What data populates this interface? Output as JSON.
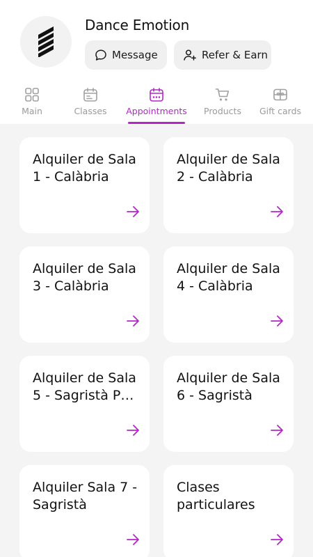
{
  "studio": {
    "name": "Dance Emotion"
  },
  "actions": {
    "message_label": "Message",
    "refer_label": "Refer & Earn"
  },
  "tabs": [
    {
      "label": "Main",
      "icon": "grid-icon",
      "active": false
    },
    {
      "label": "Classes",
      "icon": "calendar-icon",
      "active": false
    },
    {
      "label": "Appointments",
      "icon": "calendar-dots-icon",
      "active": true
    },
    {
      "label": "Products",
      "icon": "cart-icon",
      "active": false
    },
    {
      "label": "Gift cards",
      "icon": "gift-icon",
      "active": false
    }
  ],
  "cards": [
    {
      "line1": "Alquiler de Sala",
      "line2": "1 - Calàbria"
    },
    {
      "line1": "Alquiler de Sala",
      "line2": "2 - Calàbria"
    },
    {
      "line1": "Alquiler de Sala",
      "line2": "3 - Calàbria"
    },
    {
      "line1": "Alquiler de Sala",
      "line2": "4 - Calàbria"
    },
    {
      "line1": "Alquiler de Sala",
      "line2": "5 - Sagristà PR…"
    },
    {
      "line1": "Alquiler de Sala",
      "line2": "6 - Sagristà"
    },
    {
      "line1": "Alquiler Sala 7 -",
      "line2": "Sagristà"
    },
    {
      "line1": "Clases",
      "line2": "particulares"
    }
  ],
  "colors": {
    "accent": "#b426c8",
    "inactive": "#9a9a9a",
    "background": "#f4f4f4"
  }
}
